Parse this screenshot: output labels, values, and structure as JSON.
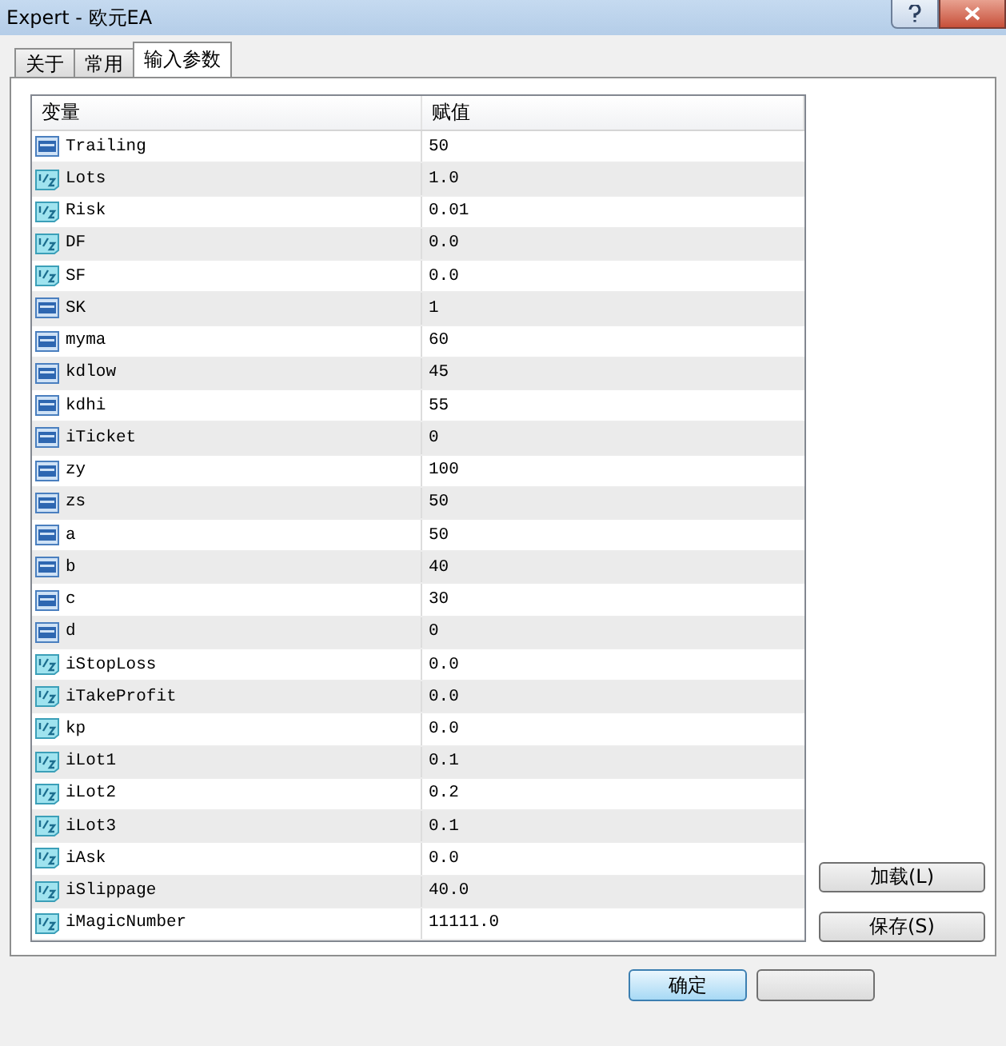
{
  "window": {
    "title": "Expert - 欧元EA"
  },
  "tabs": [
    {
      "label": "关于",
      "selected": false
    },
    {
      "label": "常用",
      "selected": false
    },
    {
      "label": "输入参数",
      "selected": true
    }
  ],
  "table": {
    "columns": [
      "变量",
      "赋值"
    ],
    "rows": [
      {
        "kind": "int",
        "name": "Trailing",
        "value": "50"
      },
      {
        "kind": "double",
        "name": "Lots",
        "value": "1.0"
      },
      {
        "kind": "double",
        "name": "Risk",
        "value": "0.01"
      },
      {
        "kind": "double",
        "name": "DF",
        "value": "0.0"
      },
      {
        "kind": "double",
        "name": "SF",
        "value": "0.0"
      },
      {
        "kind": "int",
        "name": "SK",
        "value": "1"
      },
      {
        "kind": "int",
        "name": "myma",
        "value": "60"
      },
      {
        "kind": "int",
        "name": "kdlow",
        "value": "45"
      },
      {
        "kind": "int",
        "name": "kdhi",
        "value": "55"
      },
      {
        "kind": "int",
        "name": "iTicket",
        "value": "0"
      },
      {
        "kind": "int",
        "name": "zy",
        "value": "100"
      },
      {
        "kind": "int",
        "name": "zs",
        "value": "50"
      },
      {
        "kind": "int",
        "name": "a",
        "value": "50"
      },
      {
        "kind": "int",
        "name": "b",
        "value": "40"
      },
      {
        "kind": "int",
        "name": "c",
        "value": "30"
      },
      {
        "kind": "int",
        "name": "d",
        "value": "0"
      },
      {
        "kind": "double",
        "name": "iStopLoss",
        "value": "0.0"
      },
      {
        "kind": "double",
        "name": "iTakeProfit",
        "value": "0.0"
      },
      {
        "kind": "double",
        "name": "kp",
        "value": "0.0"
      },
      {
        "kind": "double",
        "name": "iLot1",
        "value": "0.1"
      },
      {
        "kind": "double",
        "name": "iLot2",
        "value": "0.2"
      },
      {
        "kind": "double",
        "name": "iLot3",
        "value": "0.1"
      },
      {
        "kind": "double",
        "name": "iAsk",
        "value": "0.0"
      },
      {
        "kind": "double",
        "name": "iSlippage",
        "value": "40.0"
      },
      {
        "kind": "double",
        "name": "iMagicNumber",
        "value": "11111.0"
      }
    ]
  },
  "side_buttons": [
    "加载(L)",
    "保存(S)"
  ],
  "bottom_buttons": [
    "确定"
  ]
}
